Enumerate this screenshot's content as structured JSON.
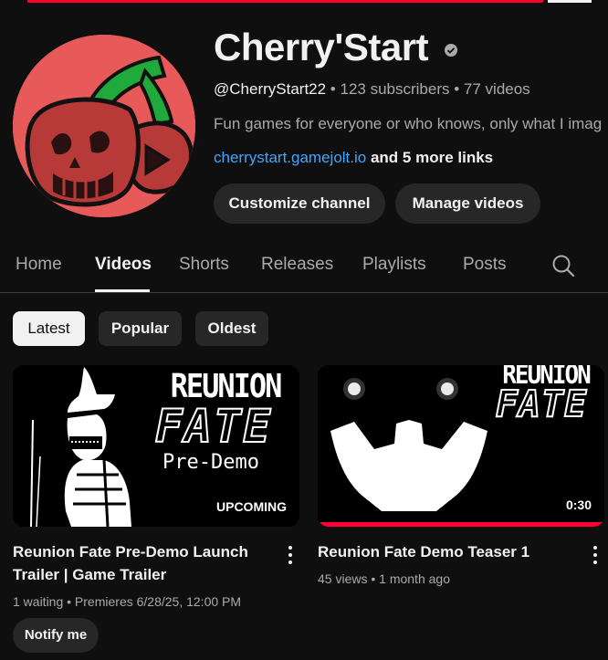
{
  "channel": {
    "name": "Cherry'Start",
    "handle": "@CherryStart22",
    "subscribers": "123 subscribers",
    "videos_count": "77 videos",
    "separator": " • ",
    "description": "Fun games for everyone or who knows, only what I imag",
    "link": "cherrystart.gamejolt.io",
    "more_links": " and 5 more links",
    "verified_icon": "checkmark-badge-icon",
    "avatar_icon": "cherry-logo-icon"
  },
  "actions": {
    "customize": "Customize channel",
    "manage": "Manage videos"
  },
  "tabs": [
    {
      "label": "Home"
    },
    {
      "label": "Videos"
    },
    {
      "label": "Shorts"
    },
    {
      "label": "Releases"
    },
    {
      "label": "Playlists"
    },
    {
      "label": "Posts"
    }
  ],
  "active_tab": "Videos",
  "search_icon": "search-icon",
  "filters": [
    {
      "label": "Latest"
    },
    {
      "label": "Popular"
    },
    {
      "label": "Oldest"
    }
  ],
  "active_filter": "Latest",
  "videos": [
    {
      "title": "Reunion Fate Pre-Demo Launch Trailer | Game Trailer",
      "meta": "1 waiting • Premieres 6/28/25, 12:00 PM",
      "badge": "UPCOMING",
      "thumb_title": "REUNION",
      "thumb_subtitle": "FATE",
      "thumb_caption": "Pre-Demo",
      "action": "Notify me"
    },
    {
      "title": "Reunion Fate Demo Teaser 1",
      "meta": "45 views • 1 month ago",
      "badge": "0:30",
      "thumb_title": "REUNION",
      "thumb_subtitle": "FATE",
      "watched_fraction": 1.0
    }
  ],
  "colors": {
    "background": "#0f0f0f",
    "accent": "#ff0033",
    "link": "#3ea6ff",
    "avatar": "#e85959",
    "cherry_dark": "#b83a38",
    "stem": "#1faa3b"
  }
}
